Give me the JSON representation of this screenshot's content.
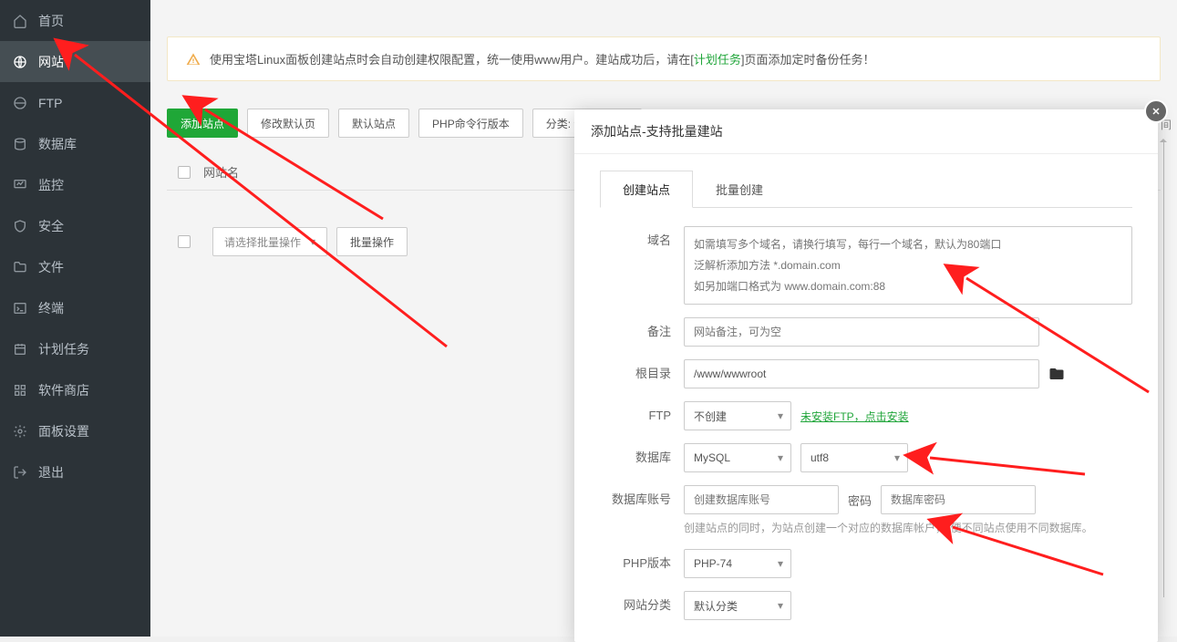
{
  "sidebar": {
    "items": [
      {
        "label": "首页",
        "icon": "home-icon"
      },
      {
        "label": "网站",
        "icon": "globe-icon"
      },
      {
        "label": "FTP",
        "icon": "globe2-icon"
      },
      {
        "label": "数据库",
        "icon": "database-icon"
      },
      {
        "label": "监控",
        "icon": "monitor-icon"
      },
      {
        "label": "安全",
        "icon": "shield-icon"
      },
      {
        "label": "文件",
        "icon": "folder-icon"
      },
      {
        "label": "终端",
        "icon": "terminal-icon"
      },
      {
        "label": "计划任务",
        "icon": "schedule-icon"
      },
      {
        "label": "软件商店",
        "icon": "apps-icon"
      },
      {
        "label": "面板设置",
        "icon": "gear-icon"
      },
      {
        "label": "退出",
        "icon": "logout-icon"
      }
    ]
  },
  "notice": {
    "pre": "使用宝塔Linux面板创建站点时会自动创建权限配置，统一使用www用户。建站成功后，请在[",
    "link": "计划任务",
    "post": "]页面添加定时备份任务！"
  },
  "toolbar": {
    "add": "添加站点",
    "modify_default": "修改默认页",
    "default_site": "默认站点",
    "php_cli": "PHP命令行版本",
    "category_label": "分类: 全部分类"
  },
  "table": {
    "header_name": "网站名"
  },
  "batch": {
    "select_placeholder": "请选择批量操作",
    "batch_op": "批量操作"
  },
  "right_trunc": "间",
  "modal": {
    "title": "添加站点-支持批量建站",
    "tabs": {
      "create": "创建站点",
      "batch": "批量创建"
    },
    "labels": {
      "domain": "域名",
      "remark": "备注",
      "root": "根目录",
      "ftp": "FTP",
      "db": "数据库",
      "db_account": "数据库账号",
      "password": "密码",
      "php": "PHP版本",
      "category": "网站分类"
    },
    "domain_placeholder": "如需填写多个域名，请换行填写，每行一个域名，默认为80端口\n泛解析添加方法 *.domain.com\n如另加端口格式为 www.domain.com:88",
    "remark_placeholder": "网站备注，可为空",
    "root_value": "/www/wwwroot",
    "ftp_select": "不创建",
    "ftp_hint": "未安装FTP，点击安装",
    "db_select": "MySQL",
    "charset_select": "utf8",
    "db_account_placeholder": "创建数据库账号",
    "db_password_placeholder": "数据库密码",
    "db_hint": "创建站点的同时，为站点创建一个对应的数据库帐户，*便不同站点使用不同数据库。",
    "php_select": "PHP-74",
    "category_select": "默认分类"
  }
}
